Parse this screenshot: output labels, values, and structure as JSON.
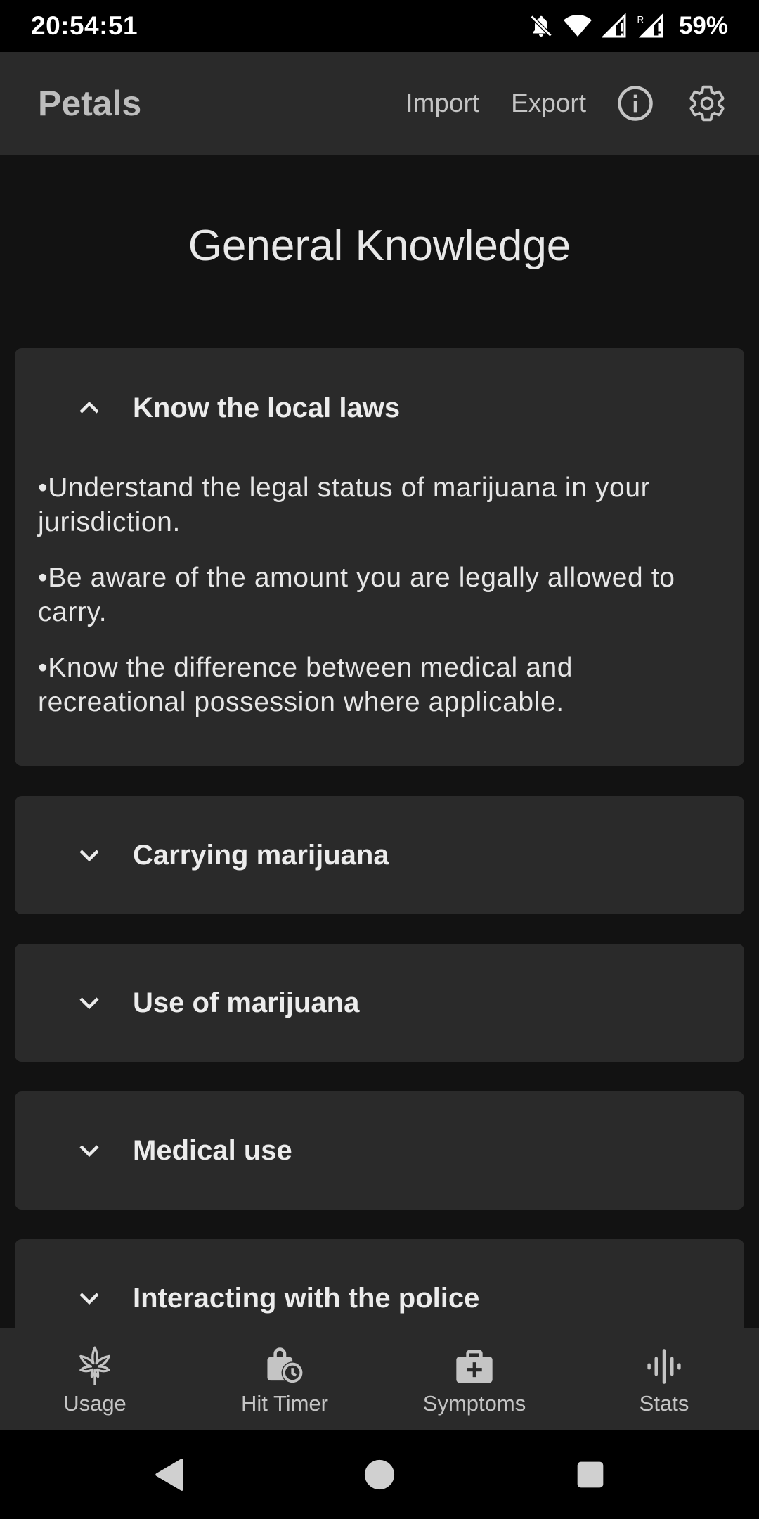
{
  "status_bar": {
    "time": "20:54:51",
    "battery": "59%",
    "icons": [
      "notifications-off-icon",
      "wifi-icon",
      "signal-icon",
      "signal-roaming-icon"
    ]
  },
  "app_bar": {
    "title": "Petals",
    "import_label": "Import",
    "export_label": "Export",
    "icons": [
      "info-icon",
      "gear-icon"
    ]
  },
  "page": {
    "title": "General Knowledge"
  },
  "cards": [
    {
      "title": "Know the local laws",
      "expanded": true,
      "bullets": [
        "•Understand the legal status of marijuana in your jurisdiction.",
        "•Be aware of the amount you are legally allowed to carry.",
        "•Know the difference between medical and recreational possession where applicable."
      ]
    },
    {
      "title": "Carrying marijuana",
      "expanded": false
    },
    {
      "title": "Use of marijuana",
      "expanded": false
    },
    {
      "title": "Medical use",
      "expanded": false
    },
    {
      "title": "Interacting with the police",
      "expanded": false
    }
  ],
  "bottom_nav": [
    {
      "label": "Usage",
      "icon": "cannabis-leaf-icon"
    },
    {
      "label": "Hit Timer",
      "icon": "timer-bag-icon"
    },
    {
      "label": "Symptoms",
      "icon": "medical-kit-icon"
    },
    {
      "label": "Stats",
      "icon": "bars-icon"
    }
  ],
  "system_nav": [
    "back-icon",
    "home-icon",
    "recents-icon"
  ],
  "colors": {
    "background": "#121212",
    "surface": "#2a2a2a",
    "status_bar": "#000000",
    "text_primary": "#e6e6e6",
    "text_secondary": "#c4c4c4"
  }
}
